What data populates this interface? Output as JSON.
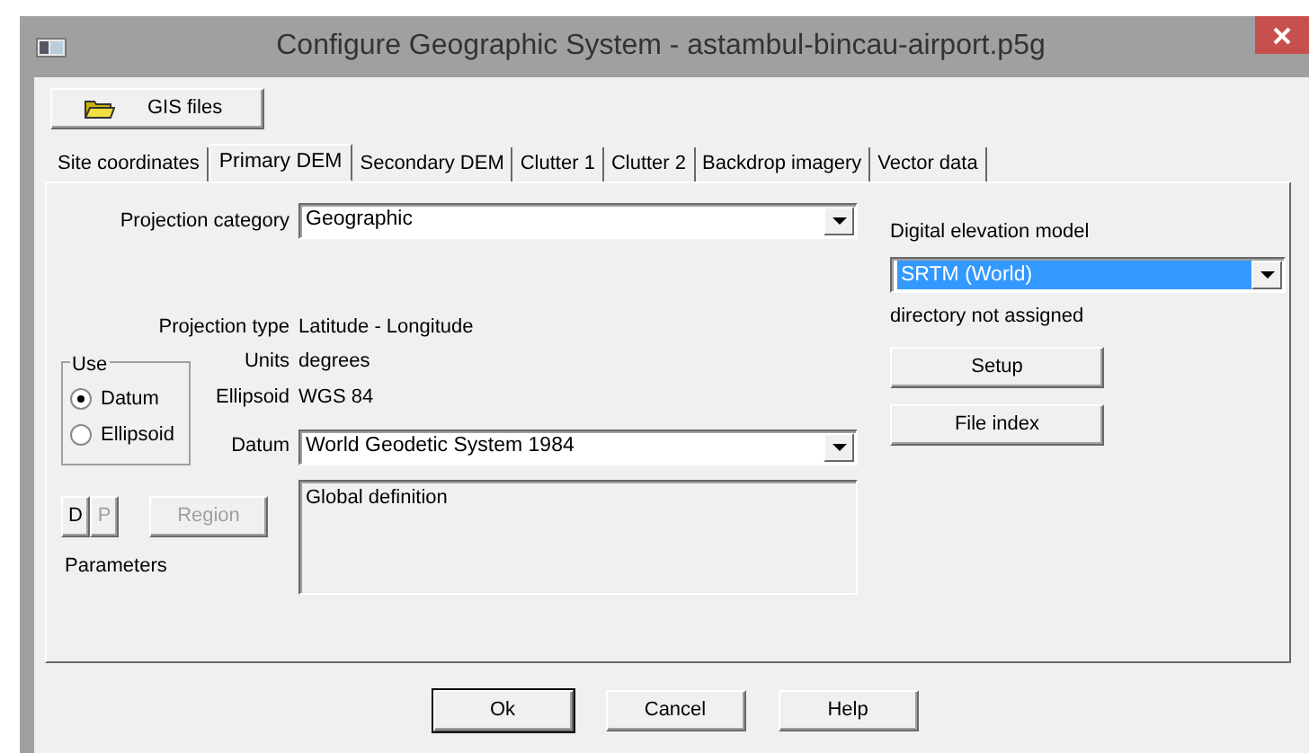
{
  "window": {
    "title": "Configure Geographic System - astambul-bincau-airport.p5g"
  },
  "toolbar": {
    "gis_files_button": "GIS files"
  },
  "tabs": [
    {
      "label": "Site coordinates",
      "selected": false
    },
    {
      "label": "Primary DEM",
      "selected": true
    },
    {
      "label": "Secondary DEM",
      "selected": false
    },
    {
      "label": "Clutter 1",
      "selected": false
    },
    {
      "label": "Clutter 2",
      "selected": false
    },
    {
      "label": "Backdrop imagery",
      "selected": false
    },
    {
      "label": "Vector data",
      "selected": false
    }
  ],
  "projection": {
    "category_label": "Projection category",
    "category_value": "Geographic",
    "type_label": "Projection type",
    "type_value": "Latitude - Longitude",
    "units_label": "Units",
    "units_value": "degrees",
    "ellipsoid_label": "Ellipsoid",
    "ellipsoid_value": "WGS 84",
    "datum_label": "Datum",
    "datum_value": "World Geodetic System 1984",
    "definition": "Global definition"
  },
  "use_group": {
    "title": "Use",
    "options": [
      {
        "label": "Datum",
        "selected": true
      },
      {
        "label": "Ellipsoid",
        "selected": false
      }
    ]
  },
  "parameter_buttons": [
    {
      "label": "D",
      "disabled": false
    },
    {
      "label": "P",
      "disabled": true
    },
    {
      "label": "Region",
      "disabled": true
    }
  ],
  "parameters_label": "Parameters",
  "dem": {
    "label": "Digital elevation model",
    "value": "SRTM (World)",
    "focused": true,
    "status": "directory not assigned",
    "buttons": [
      "Setup",
      "File index"
    ]
  },
  "dialog_buttons": [
    {
      "label": "Ok",
      "default": true
    },
    {
      "label": "Cancel",
      "default": false
    },
    {
      "label": "Help",
      "default": false
    }
  ]
}
